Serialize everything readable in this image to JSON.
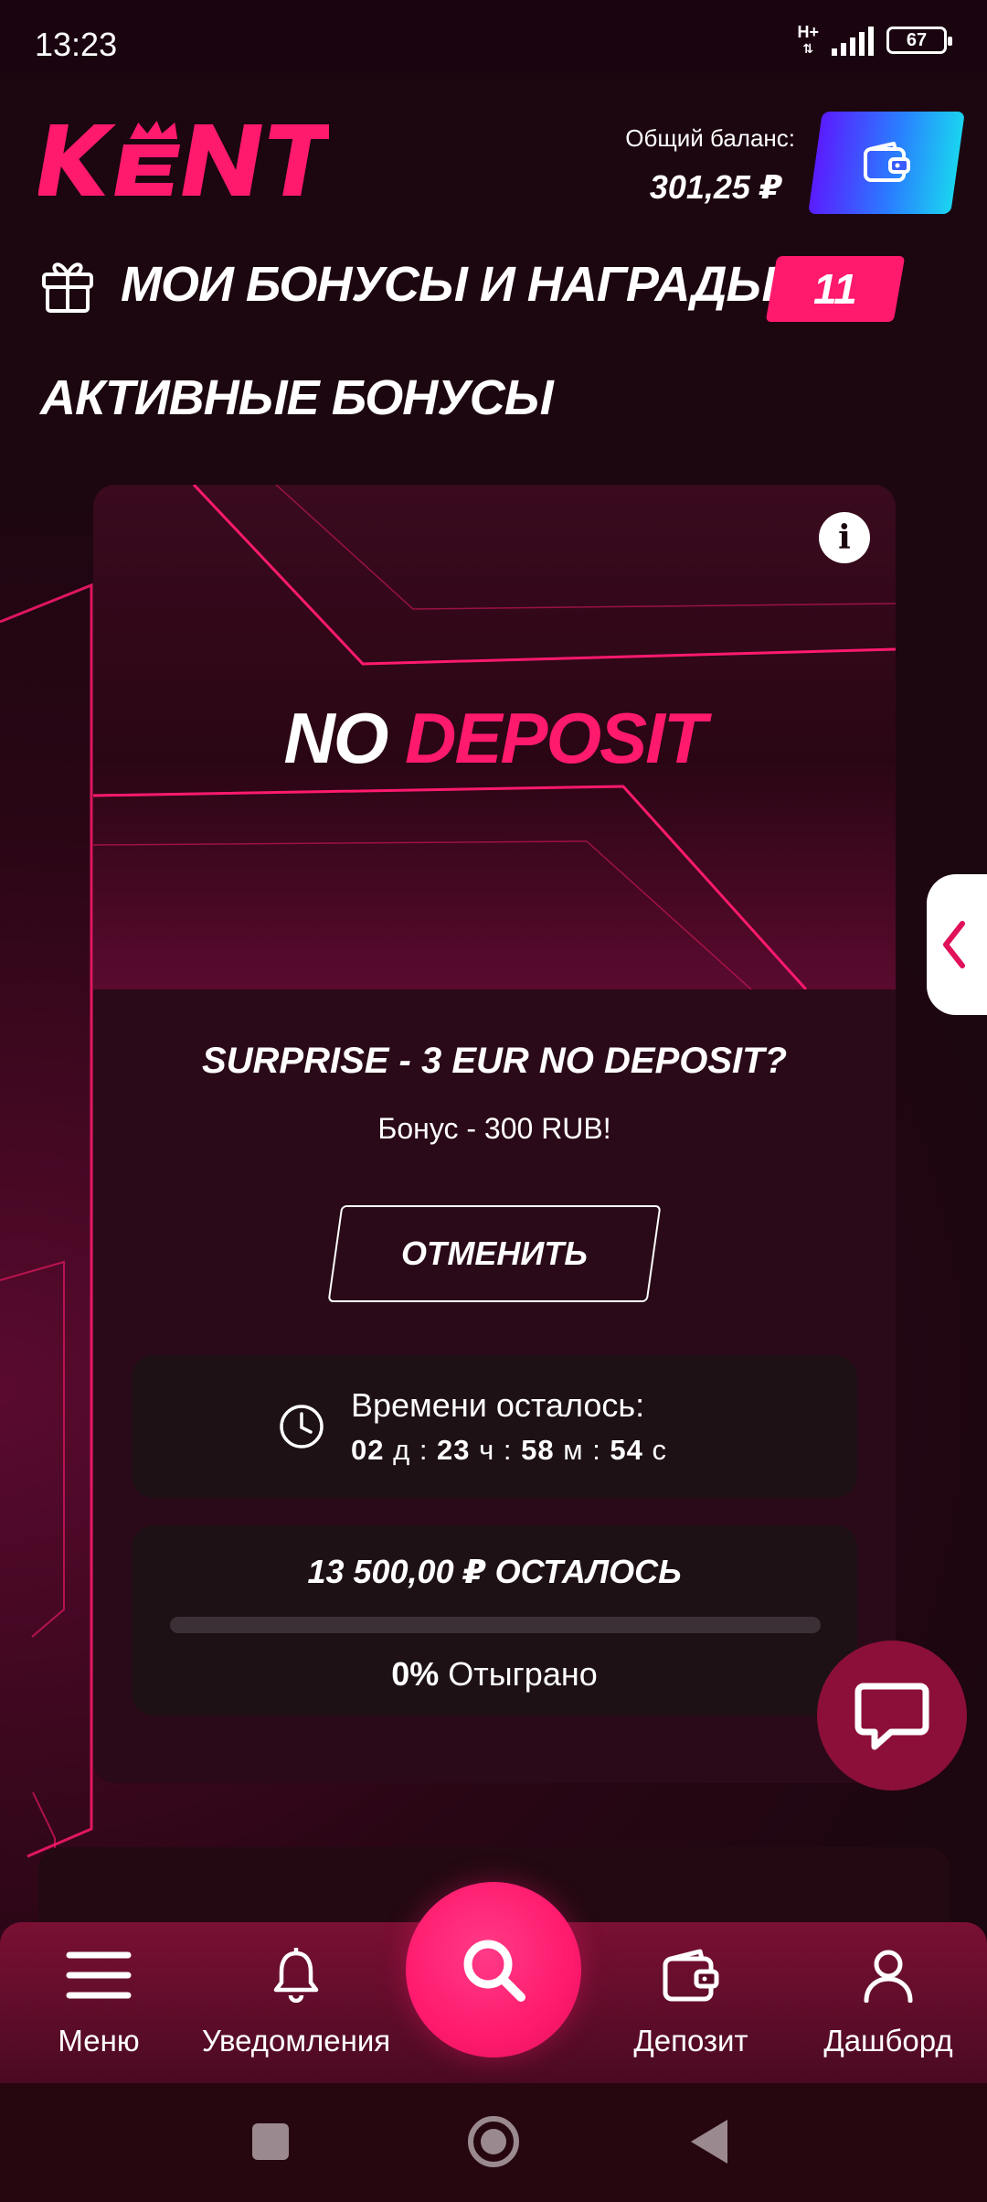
{
  "status_bar": {
    "time": "13:23",
    "network": "H+",
    "battery": "67"
  },
  "header": {
    "logo_text": "KENT",
    "balance_label": "Общий баланс:",
    "balance_value": "301,25 ₽"
  },
  "bonuses": {
    "title": "МОИ БОНУСЫ И НАГРАДЫ",
    "count": "11",
    "active_title": "АКТИВНЫЕ БОНУСЫ"
  },
  "bonus_card": {
    "banner_word1": "NO",
    "banner_word2": "DEPOSIT",
    "name": "SURPRISE - 3 EUR NO DEPOSIT?",
    "description": "Бонус - 300 RUB!",
    "cancel_label": "ОТМЕНИТЬ",
    "timer": {
      "label": "Времени осталось:",
      "days": "02",
      "days_unit": "д",
      "hours": "23",
      "hours_unit": "ч",
      "minutes": "58",
      "minutes_unit": "м",
      "seconds": "54",
      "seconds_unit": "с"
    },
    "wager": {
      "remaining": "13 500,00 ₽ ОСТАЛОСЬ",
      "percent": "0%",
      "played_label": "Отыграно",
      "progress_fraction": 0
    }
  },
  "bottom_nav": {
    "items": [
      {
        "label": "Меню",
        "icon": "menu-icon"
      },
      {
        "label": "Уведомления",
        "icon": "bell-icon"
      },
      {
        "label": "Депозит",
        "icon": "wallet-icon"
      },
      {
        "label": "Дашборд",
        "icon": "user-icon"
      }
    ],
    "center_icon": "search-icon"
  },
  "colors": {
    "accent": "#ff1a6e",
    "background": "#1c0610",
    "card": "#2a0a18"
  }
}
